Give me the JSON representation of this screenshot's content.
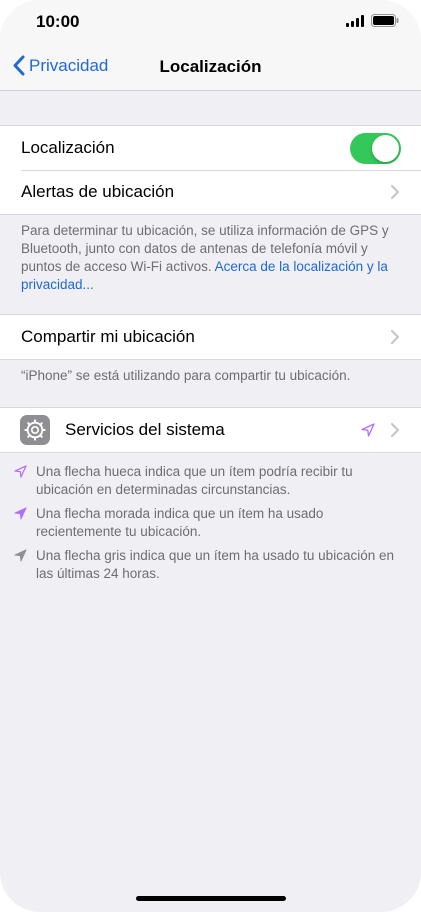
{
  "status_bar": {
    "time": "10:00"
  },
  "nav": {
    "back_label": "Privacidad",
    "title": "Localización"
  },
  "group1": {
    "location_label": "Localización",
    "location_enabled": true,
    "alerts_label": "Alertas de ubicación"
  },
  "footer1": {
    "text": "Para determinar tu ubicación, se utiliza información de GPS y Bluetooth, junto con datos de antenas de telefonía móvil y puntos de acceso Wi-Fi activos. ",
    "link": "Acerca de la localización y la privacidad..."
  },
  "group2": {
    "share_label": "Compartir mi ubicación"
  },
  "footer2": {
    "text": "“iPhone” se está utilizando para compartir tu ubicación."
  },
  "group3": {
    "system_label": "Servicios del sistema",
    "system_icon": "gear-icon"
  },
  "legend": {
    "hollow": "Una flecha hueca indica que un ítem podría recibir tu ubicación en determinadas circunstancias.",
    "purple": "Una flecha morada indica que un ítem ha usado recientemente tu ubicación.",
    "gray": "Una flecha gris indica que un ítem ha usado tu ubicación en las últimas 24 horas."
  },
  "colors": {
    "accent": "#1f69d6",
    "toggle_on": "#34c759",
    "purple_arrow": "#b46cff",
    "gray_arrow": "#8e8e93"
  }
}
